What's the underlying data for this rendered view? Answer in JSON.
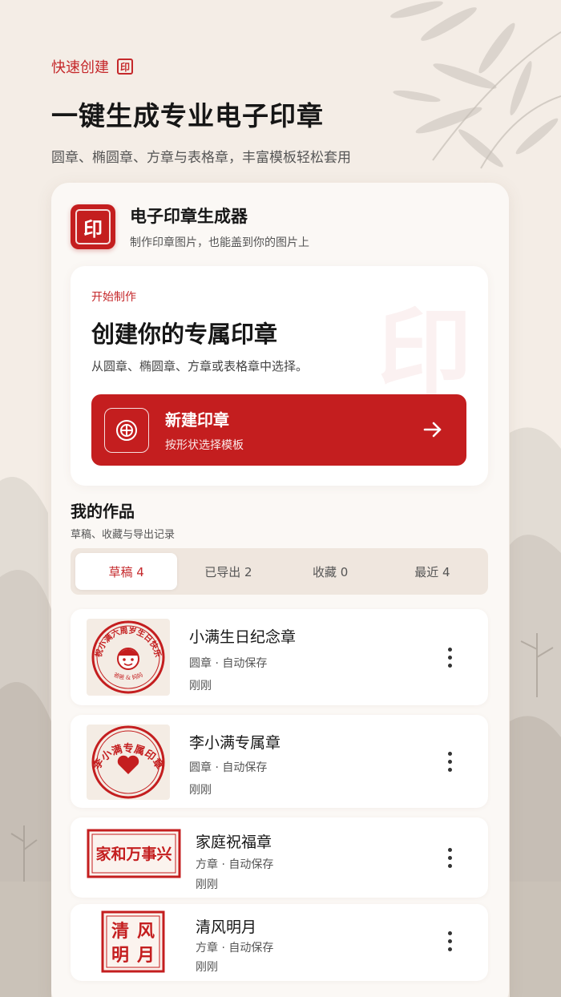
{
  "hero": {
    "tag": "快速创建",
    "tag_seal": "印",
    "title": "一键生成专业电子印章",
    "subtitle": "圆章、椭圆章、方章与表格章，丰富模板轻松套用"
  },
  "app": {
    "logo_char": "印",
    "name": "电子印章生成器",
    "description": "制作印章图片，也能盖到你的图片上"
  },
  "create": {
    "kicker": "开始制作",
    "title": "创建你的专属印章",
    "description": "从圆章、椭圆章、方章或表格章中选择。",
    "watermark": "印",
    "button_title": "新建印章",
    "button_subtitle": "按形状选择模板"
  },
  "works": {
    "title": "我的作品",
    "subtitle": "草稿、收藏与导出记录",
    "tabs": [
      {
        "label": "草稿 4"
      },
      {
        "label": "已导出 2"
      },
      {
        "label": "收藏 0"
      },
      {
        "label": "最近 4"
      }
    ],
    "items": [
      {
        "name": "小满生日纪念章",
        "meta": "圆章 · 自动保存",
        "time": "刚刚",
        "seal_top": "祝小满六周岁生日快乐",
        "seal_bottom": "爸爸 & 妈妈"
      },
      {
        "name": "李小满专属章",
        "meta": "圆章 · 自动保存",
        "time": "刚刚",
        "seal_top": "李小满专属印章"
      },
      {
        "name": "家庭祝福章",
        "meta": "方章 · 自动保存",
        "time": "刚刚",
        "seal_text": "家和万事兴"
      },
      {
        "name": "清风明月",
        "meta": "方章 · 自动保存",
        "time": "刚刚",
        "seal_chars": [
          "清",
          "风",
          "明",
          "月"
        ]
      }
    ]
  },
  "colors": {
    "accent": "#c41e1f",
    "background": "#f4ede6",
    "card": "#fbf8f5"
  }
}
